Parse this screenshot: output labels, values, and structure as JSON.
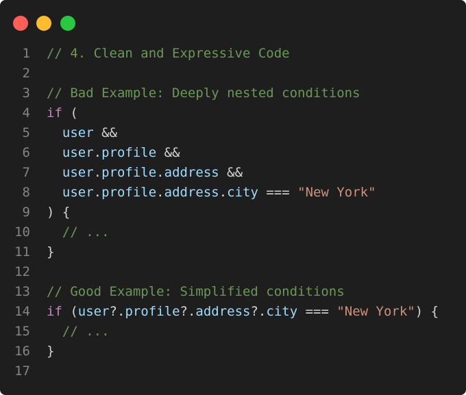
{
  "window": {
    "controls": {
      "close_color": "#ff5f57",
      "minimize_color": "#febc2e",
      "maximize_color": "#28c840"
    }
  },
  "theme": {
    "background": "#1e1e1e",
    "line_number": "#858585",
    "comment": "#6a9955",
    "keyword": "#c586c0",
    "identifier": "#9cdcfe",
    "punctuation": "#d4d4d4",
    "string": "#ce9178"
  },
  "lines": [
    {
      "n": "1",
      "tokens": [
        {
          "t": "comment",
          "v": "// 4. Clean and Expressive Code"
        }
      ]
    },
    {
      "n": "2",
      "tokens": []
    },
    {
      "n": "3",
      "tokens": [
        {
          "t": "comment",
          "v": "// Bad Example: Deeply nested conditions"
        }
      ]
    },
    {
      "n": "4",
      "tokens": [
        {
          "t": "keyword",
          "v": "if"
        },
        {
          "t": "punct",
          "v": " ("
        }
      ]
    },
    {
      "n": "5",
      "tokens": [
        {
          "t": "ident",
          "v": "  user"
        },
        {
          "t": "op",
          "v": " &&"
        }
      ]
    },
    {
      "n": "6",
      "tokens": [
        {
          "t": "ident",
          "v": "  user"
        },
        {
          "t": "punct",
          "v": "."
        },
        {
          "t": "ident",
          "v": "profile"
        },
        {
          "t": "op",
          "v": " &&"
        }
      ]
    },
    {
      "n": "7",
      "tokens": [
        {
          "t": "ident",
          "v": "  user"
        },
        {
          "t": "punct",
          "v": "."
        },
        {
          "t": "ident",
          "v": "profile"
        },
        {
          "t": "punct",
          "v": "."
        },
        {
          "t": "ident",
          "v": "address"
        },
        {
          "t": "op",
          "v": " &&"
        }
      ]
    },
    {
      "n": "8",
      "tokens": [
        {
          "t": "ident",
          "v": "  user"
        },
        {
          "t": "punct",
          "v": "."
        },
        {
          "t": "ident",
          "v": "profile"
        },
        {
          "t": "punct",
          "v": "."
        },
        {
          "t": "ident",
          "v": "address"
        },
        {
          "t": "punct",
          "v": "."
        },
        {
          "t": "ident",
          "v": "city"
        },
        {
          "t": "op",
          "v": " === "
        },
        {
          "t": "string",
          "v": "\"New York\""
        }
      ]
    },
    {
      "n": "9",
      "tokens": [
        {
          "t": "punct",
          "v": ") {"
        }
      ]
    },
    {
      "n": "10",
      "tokens": [
        {
          "t": "comment",
          "v": "  // ..."
        }
      ]
    },
    {
      "n": "11",
      "tokens": [
        {
          "t": "punct",
          "v": "}"
        }
      ]
    },
    {
      "n": "12",
      "tokens": []
    },
    {
      "n": "13",
      "tokens": [
        {
          "t": "comment",
          "v": "// Good Example: Simplified conditions"
        }
      ]
    },
    {
      "n": "14",
      "tokens": [
        {
          "t": "keyword",
          "v": "if"
        },
        {
          "t": "punct",
          "v": " ("
        },
        {
          "t": "ident",
          "v": "user"
        },
        {
          "t": "punct",
          "v": "?."
        },
        {
          "t": "ident",
          "v": "profile"
        },
        {
          "t": "punct",
          "v": "?."
        },
        {
          "t": "ident",
          "v": "address"
        },
        {
          "t": "punct",
          "v": "?."
        },
        {
          "t": "ident",
          "v": "city"
        },
        {
          "t": "op",
          "v": " === "
        },
        {
          "t": "string",
          "v": "\"New York\""
        },
        {
          "t": "punct",
          "v": ") {"
        }
      ]
    },
    {
      "n": "15",
      "tokens": [
        {
          "t": "comment",
          "v": "  // ..."
        }
      ]
    },
    {
      "n": "16",
      "tokens": [
        {
          "t": "punct",
          "v": "}"
        }
      ]
    },
    {
      "n": "17",
      "tokens": []
    }
  ]
}
